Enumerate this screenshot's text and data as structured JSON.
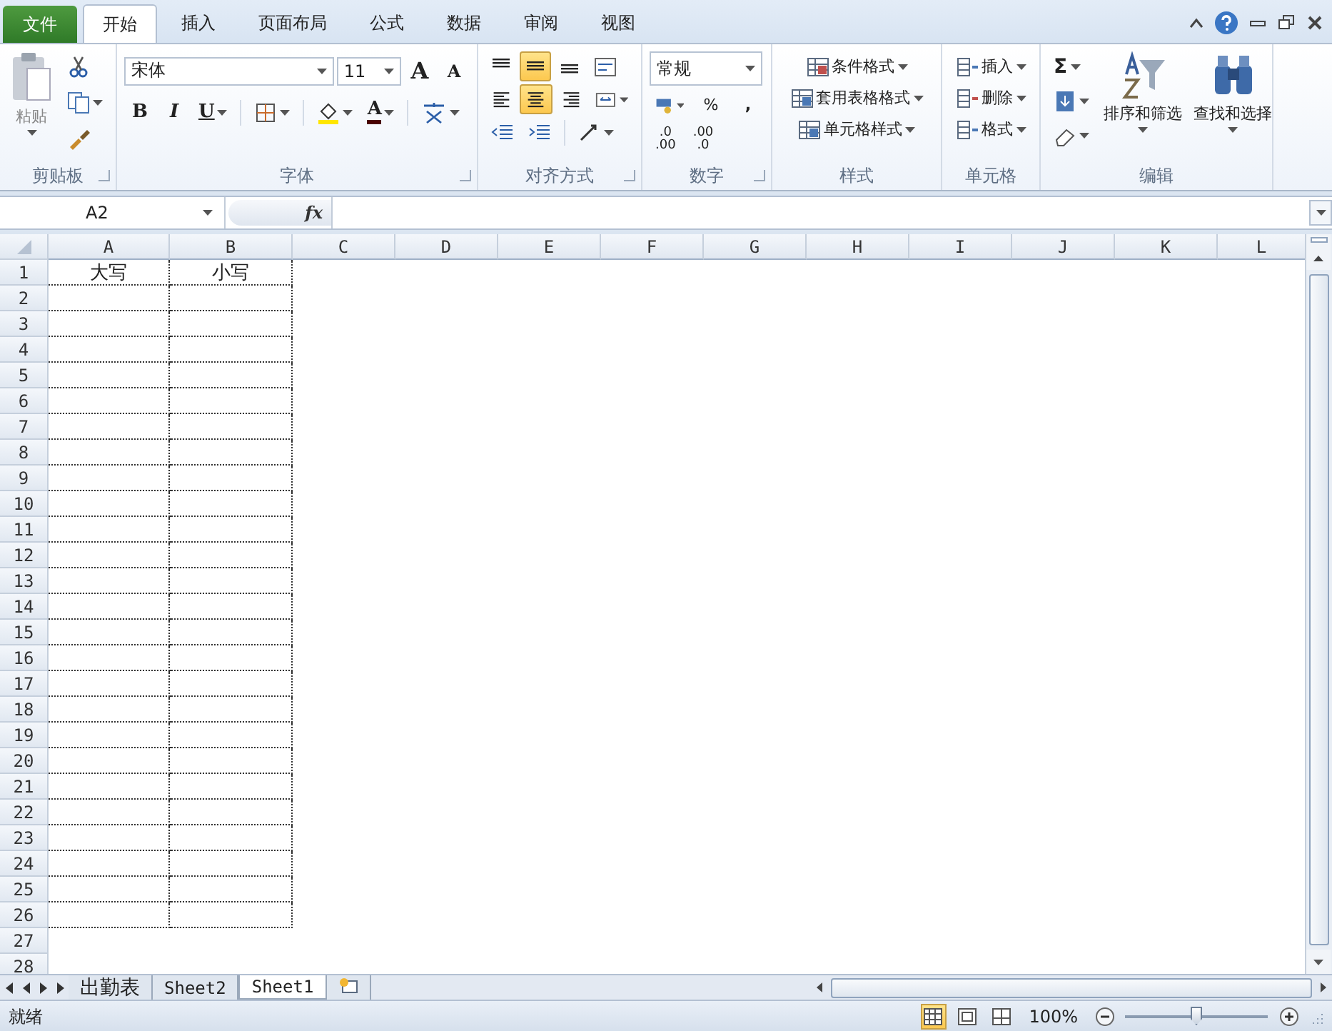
{
  "ribbon_tabs": [
    {
      "label": "文件",
      "kind": "file",
      "selected": false
    },
    {
      "label": "开始",
      "kind": "tab",
      "selected": true
    },
    {
      "label": "插入",
      "kind": "tab",
      "selected": false
    },
    {
      "label": "页面布局",
      "kind": "tab",
      "selected": false
    },
    {
      "label": "公式",
      "kind": "tab",
      "selected": false
    },
    {
      "label": "数据",
      "kind": "tab",
      "selected": false
    },
    {
      "label": "审阅",
      "kind": "tab",
      "selected": false
    },
    {
      "label": "视图",
      "kind": "tab",
      "selected": false
    }
  ],
  "clipboard": {
    "label": "剪贴板",
    "paste": "粘贴"
  },
  "font": {
    "label": "字体",
    "font_name": "宋体",
    "font_size": "11",
    "grow": "A",
    "shrink": "A",
    "bold": "B",
    "italic": "I",
    "underline": "U",
    "font_color": "A"
  },
  "alignment": {
    "label": "对齐方式",
    "buttons": [
      {
        "kind": "top",
        "selected": false
      },
      {
        "kind": "middle",
        "selected": true
      },
      {
        "kind": "bottom",
        "selected": false
      },
      {
        "kind": "left",
        "selected": false
      },
      {
        "kind": "center",
        "selected": true
      },
      {
        "kind": "right",
        "selected": false
      }
    ]
  },
  "number": {
    "label": "数字",
    "format": "常规",
    "percent": "%",
    "comma": ",",
    "decimal_increase": [
      ".0",
      ".00"
    ],
    "decimal_decrease": [
      ".00",
      ".0"
    ]
  },
  "styles": {
    "label": "样式",
    "items": [
      "条件格式",
      "套用表格格式",
      "单元格样式"
    ]
  },
  "cells": {
    "label": "单元格",
    "items": [
      "插入",
      "删除",
      "格式"
    ]
  },
  "editing": {
    "label": "编辑",
    "sum": "Σ",
    "sort": "排序和筛选",
    "find": "查找和选择"
  },
  "formula_bar": {
    "name_box": "A2",
    "function_label": "fx"
  },
  "grid": {
    "columns": [
      "A",
      "B",
      "C",
      "D",
      "E",
      "F",
      "G",
      "H",
      "I",
      "J",
      "K",
      "L"
    ],
    "rows": [
      {
        "header": "1",
        "bordered": true,
        "cells": [
          "大写",
          "小写"
        ]
      },
      {
        "header": "2",
        "bordered": true
      },
      {
        "header": "3",
        "bordered": true
      },
      {
        "header": "4",
        "bordered": true
      },
      {
        "header": "5",
        "bordered": true
      },
      {
        "header": "6",
        "bordered": true
      },
      {
        "header": "7",
        "bordered": true
      },
      {
        "header": "8",
        "bordered": true
      },
      {
        "header": "9",
        "bordered": true
      },
      {
        "header": "10",
        "bordered": true
      },
      {
        "header": "11",
        "bordered": true
      },
      {
        "header": "12",
        "bordered": true
      },
      {
        "header": "13",
        "bordered": true
      },
      {
        "header": "14",
        "bordered": true
      },
      {
        "header": "15",
        "bordered": true
      },
      {
        "header": "16",
        "bordered": true
      },
      {
        "header": "17",
        "bordered": true
      },
      {
        "header": "18",
        "bordered": true
      },
      {
        "header": "19",
        "bordered": true
      },
      {
        "header": "20",
        "bordered": true
      },
      {
        "header": "21",
        "bordered": true
      },
      {
        "header": "22",
        "bordered": true
      },
      {
        "header": "23",
        "bordered": true
      },
      {
        "header": "24",
        "bordered": true
      },
      {
        "header": "25",
        "bordered": true
      },
      {
        "header": "26",
        "bordered": true
      },
      {
        "header": "27",
        "bordered": false
      },
      {
        "header": "28",
        "bordered": false
      }
    ]
  },
  "sheet_tabs": [
    {
      "label": "出勤表",
      "selected": false
    },
    {
      "label": "Sheet2",
      "selected": false
    },
    {
      "label": "Sheet1",
      "selected": true
    }
  ],
  "status_bar": {
    "status": "就绪",
    "views": [
      {
        "kind": "normal",
        "selected": true
      },
      {
        "kind": "layout",
        "selected": false
      },
      {
        "kind": "break",
        "selected": false
      }
    ],
    "zoom": "100%",
    "zoom_slider": {
      "level": 0.5
    }
  }
}
